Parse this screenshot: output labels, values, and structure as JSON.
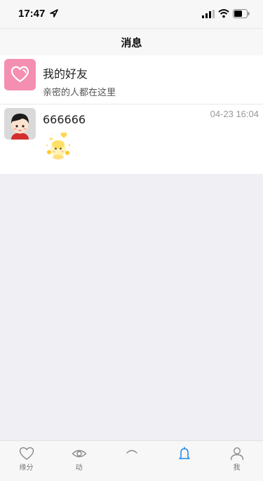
{
  "status_bar": {
    "time": "17:47"
  },
  "header": {
    "title": "消息"
  },
  "conversations": [
    {
      "title": "我的好友",
      "subtitle": "亲密的人都在这里",
      "avatar_icon": "heart-icon",
      "avatar_color": "#f48fb1"
    },
    {
      "title": "666666",
      "time": "04-23 16:04",
      "avatar_icon": "user-avatar",
      "preview_icon": "sticker-image"
    }
  ],
  "tab_bar": {
    "tabs": [
      {
        "label": "缘分",
        "icon": "heart-outline-icon"
      },
      {
        "label": "动",
        "icon": "eye-icon"
      },
      {
        "label": "",
        "icon": "center-arc-icon"
      },
      {
        "label": "",
        "icon": "bell-icon",
        "active": true
      },
      {
        "label": "我",
        "icon": "person-icon"
      }
    ],
    "active_color": "#1e88e5",
    "inactive_color": "#8a8a8a"
  }
}
